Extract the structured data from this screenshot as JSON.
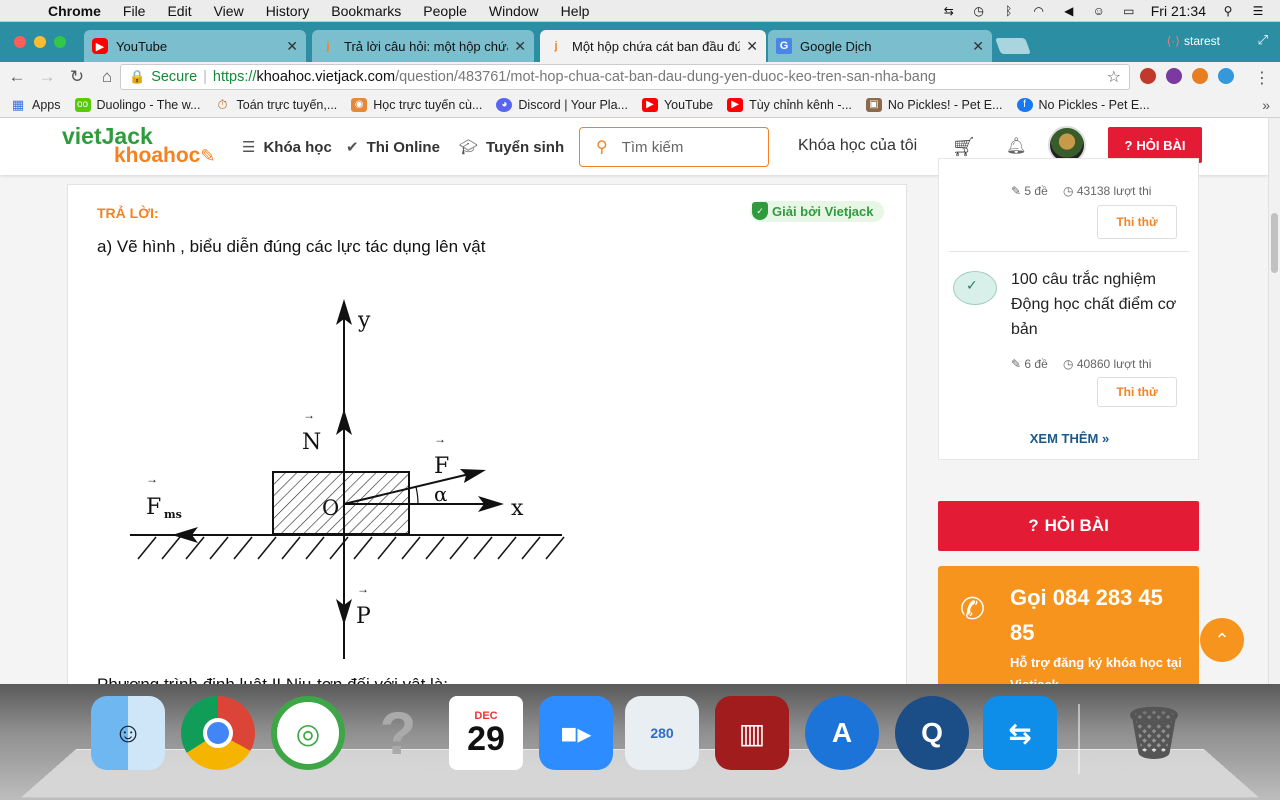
{
  "menubar": {
    "apple": "",
    "items": [
      "Chrome",
      "File",
      "Edit",
      "View",
      "History",
      "Bookmarks",
      "People",
      "Window",
      "Help"
    ],
    "clock": "Fri 21:34"
  },
  "tabs": [
    {
      "title": "YouTube",
      "icon": "youtube-icon",
      "active": false
    },
    {
      "title": "Trả lời câu hỏi: một hộp chứa",
      "icon": "vietjack-icon",
      "active": false
    },
    {
      "title": "Một hộp chứa cát ban đầu đứ",
      "icon": "vietjack-icon",
      "active": true
    },
    {
      "title": "Google Dịch",
      "icon": "google-translate-icon",
      "active": false
    }
  ],
  "profile": "starest",
  "omnibox": {
    "secure_label": "Secure",
    "protocol": "https://",
    "host": "khoahoc.vietjack.com",
    "path": "/question/483761/mot-hop-chua-cat-ban-dau-dung-yen-duoc-keo-tren-san-nha-bang"
  },
  "bookmarks": [
    {
      "label": "Apps",
      "color": "#3b6fd8"
    },
    {
      "label": "Duolingo - The w...",
      "color": "#58cc02"
    },
    {
      "label": "Toán trực tuyến,...",
      "color": "#b2702a"
    },
    {
      "label": "Học trực tuyến cù...",
      "color": "#e5883a"
    },
    {
      "label": "Discord | Your Pla...",
      "color": "#5865f2"
    },
    {
      "label": "YouTube",
      "color": "#ff0000"
    },
    {
      "label": "Tùy chỉnh kênh -...",
      "color": "#ff0000"
    },
    {
      "label": "No Pickles! - Pet E...",
      "color": "#8a6a4a"
    },
    {
      "label": "No Pickles - Pet E...",
      "color": "#1877f2"
    }
  ],
  "site": {
    "logo_top": "vietJack",
    "logo_bottom": "khoahoc",
    "nav": [
      {
        "label": "Khóa học",
        "icon": "menu-icon"
      },
      {
        "label": "Thi Online",
        "icon": "check-icon"
      },
      {
        "label": "Tuyển sinh",
        "icon": "graduation-cap-icon"
      }
    ],
    "search_placeholder": "Tìm kiếm",
    "my_courses": "Khóa học của tôi",
    "ask_button": "HỎI BÀI"
  },
  "answer": {
    "label": "TRẢ LỜI:",
    "badge": "Giải bởi Vietjack",
    "line1": "a) Vẽ hình , biểu diễn đúng các lực tác dụng lên vật",
    "diagram_labels": {
      "y": "y",
      "x": "x",
      "N": "N",
      "F": "F",
      "Fms": "F",
      "Fms_sub": "ms",
      "P": "P",
      "O": "O",
      "alpha": "α"
    },
    "next_line": "Phương trình định luật II Niu-tơn đối với vật là:"
  },
  "sidebar": {
    "course1": {
      "tests": "5 đề",
      "views": "43138 lượt thi",
      "try": "Thi thử"
    },
    "course2": {
      "title": "100 câu trắc nghiệm Động học chất điểm cơ bản",
      "tests": "6 đề",
      "views": "40860 lượt thi",
      "try": "Thi thử"
    },
    "more": "XEM THÊM »",
    "ask_big": "HỎI BÀI",
    "call_title": "Gọi 084 283 45 85",
    "call_sub": "Hỗ trợ đăng ký khóa học tại Vietjack"
  },
  "dock": {
    "calendar_month": "DEC",
    "calendar_day": "29",
    "maps_label": "280"
  }
}
